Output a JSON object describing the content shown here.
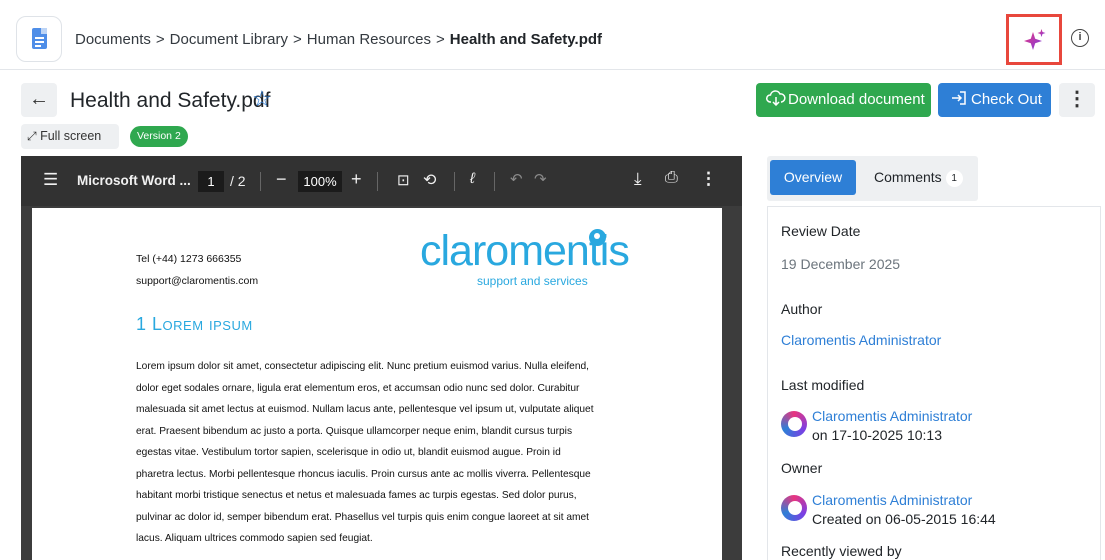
{
  "breadcrumb": {
    "items": [
      "Documents",
      "Document Library",
      "Human Resources"
    ],
    "separator": ">",
    "current": "Health and Safety.pdf"
  },
  "header": {
    "info_icon": "i"
  },
  "document": {
    "title": "Health and Safety.pdf",
    "download_label": "Download document",
    "checkout_label": "Check Out",
    "fullscreen_label": "Full screen",
    "version_label": "Version 2"
  },
  "viewer": {
    "file_name": "Microsoft Word ...",
    "current_page": "1",
    "total_pages": "/ 2",
    "zoom": "100%"
  },
  "pdf_page": {
    "phone": "Tel (+44) 1273 666355",
    "email": "support@claromentis.com",
    "logo_word": "claromentis",
    "logo_tagline": "support and services",
    "heading": "1   Lorem ipsum",
    "body_lines": [
      "Lorem ipsum dolor sit amet, consectetur adipiscing elit. Nunc pretium euismod varius. Nulla eleifend,",
      "dolor eget sodales ornare, ligula erat elementum eros, et accumsan odio nunc sed dolor. Curabitur",
      "malesuada sit amet lectus at euismod. Nullam lacus ante, pellentesque vel ipsum ut, vulputate aliquet",
      "erat. Praesent bibendum ac justo a porta. Quisque ullamcorper neque enim, blandit cursus turpis",
      "egestas vitae. Vestibulum tortor sapien, scelerisque in odio ut, blandit euismod augue. Proin id",
      "pharetra lectus. Morbi pellentesque rhoncus iaculis. Proin cursus ante ac mollis viverra. Pellentesque",
      "habitant morbi tristique senectus et netus et malesuada fames ac turpis egestas. Sed dolor purus,",
      "pulvinar ac dolor id, semper bibendum erat. Phasellus vel turpis quis enim congue laoreet at sit amet",
      "lacus. Aliquam ultrices commodo sapien sed feugiat."
    ]
  },
  "tabs": {
    "overview": "Overview",
    "comments": "Comments",
    "comments_count": "1"
  },
  "overview": {
    "review_date_label": "Review Date",
    "review_date": "19 December 2025",
    "author_label": "Author",
    "author": "Claromentis Administrator",
    "last_modified_label": "Last modified",
    "modified_by": "Claromentis Administrator",
    "modified_on": "on 17-10-2025 10:13",
    "owner_label": "Owner",
    "owner": "Claromentis Administrator",
    "created_on": "Created on 06-05-2015 16:44",
    "recently_viewed_label": "Recently viewed by"
  },
  "colors": {
    "primary": "#2e7fd6",
    "success": "#2fa84f",
    "highlight": "#e8473c",
    "brand": "#29a8df"
  },
  "icons": {
    "app": "document-icon",
    "ai": "sparkles-icon",
    "info": "info-icon",
    "back": "arrow-left-icon",
    "favorite": "star-outline-icon",
    "download": "cloud-download-icon",
    "checkout": "sign-in-icon",
    "more": "kebab-icon"
  }
}
